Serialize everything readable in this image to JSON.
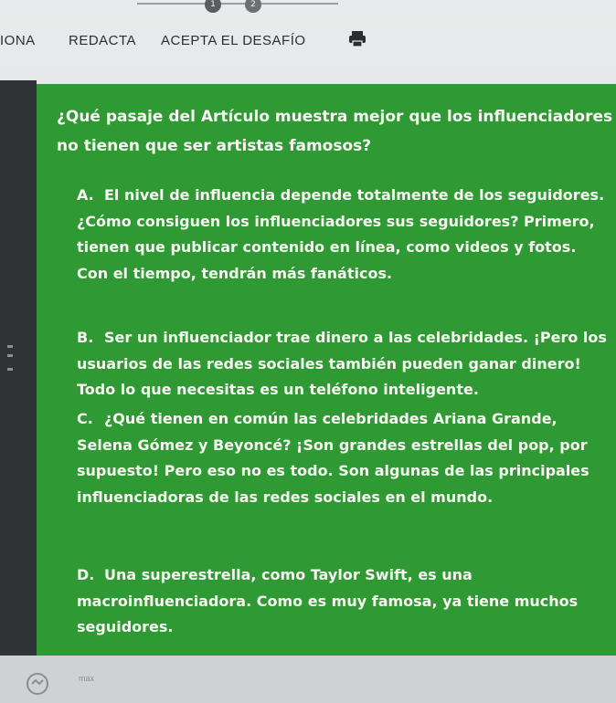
{
  "progress": {
    "steps": [
      "1",
      "2"
    ]
  },
  "nav": {
    "tabs": [
      {
        "label": "IONA"
      },
      {
        "label": "REDACTA"
      },
      {
        "label": "ACEPTA EL DESAFÍO"
      }
    ],
    "print_icon": "printer-icon"
  },
  "question": {
    "text": "¿Qué pasaje del Artículo muestra mejor que los influenciadores no tienen que ser artistas famosos?"
  },
  "options": [
    {
      "letter": "A.",
      "text": "El nivel de influencia depende totalmente de los seguidores. ¿Cómo consiguen los influenciadores sus seguidores? Primero, tienen que publicar contenido en línea, como videos y fotos. Con el tiempo, tendrán más fanáticos."
    },
    {
      "letter": "B.",
      "text": "Ser un influenciador trae dinero a las celebridades. ¡Pero los usuarios de las redes sociales también pueden ganar dinero! Todo lo que necesitas es un teléfono inteligente."
    },
    {
      "letter": "C.",
      "text": "¿Qué tienen en común las celebridades Ariana Grande, Selena Gómez y Beyoncé? ¡Son grandes estrellas del pop, por supuesto! Pero eso no es todo. Son algunas de las principales influenciadoras de las redes sociales en el mundo."
    },
    {
      "letter": "D.",
      "text": "Una superestrella, como Taylor Swift, es una macroinfluenciadora. Como es muy famosa, ya tiene muchos seguidores."
    }
  ],
  "bottom": {
    "icon": "app-icon",
    "logo_text": "max"
  },
  "colors": {
    "card_green": "#2f9a34",
    "text_light": "#f7f7f2"
  }
}
